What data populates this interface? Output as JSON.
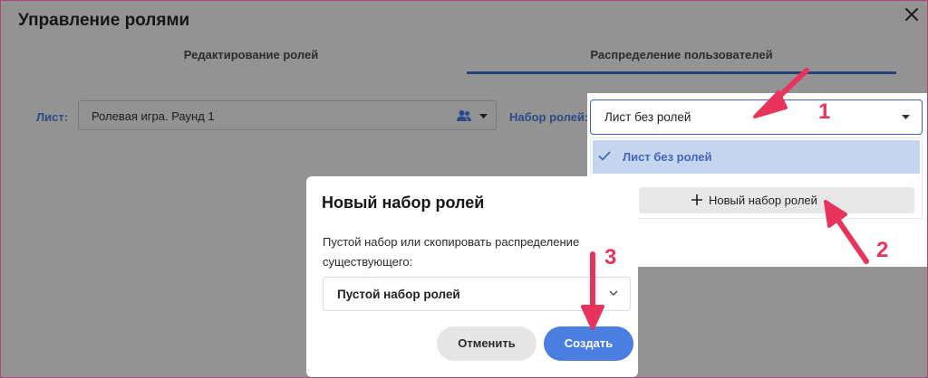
{
  "manager": {
    "title": "Управление ролями",
    "tabs": [
      {
        "label": "Редактирование ролей"
      },
      {
        "label": "Распределение пользователей"
      }
    ],
    "sheet_label": "Лист:",
    "sheet_value": "Ролевая игра. Раунд 1",
    "role_set_label": "Набор ролей:"
  },
  "role_set_dropdown": {
    "selected_value": "Лист без ролей",
    "options": [
      {
        "label": "Лист без ролей",
        "checked": true
      }
    ],
    "new_set_button": "Новый набор ролей"
  },
  "dialog": {
    "title": "Новый набор ролей",
    "description": "Пустой набор или скопировать распределение существующего:",
    "select_value": "Пустой набор ролей",
    "cancel_label": "Отменить",
    "create_label": "Создать"
  },
  "annotations": {
    "step1": "1",
    "step2": "2",
    "step3": "3"
  },
  "colors": {
    "accent": "#4a7ee0",
    "annotation": "#e8345c",
    "overlay": "#939393",
    "selected_option": "#c5d5ef"
  }
}
